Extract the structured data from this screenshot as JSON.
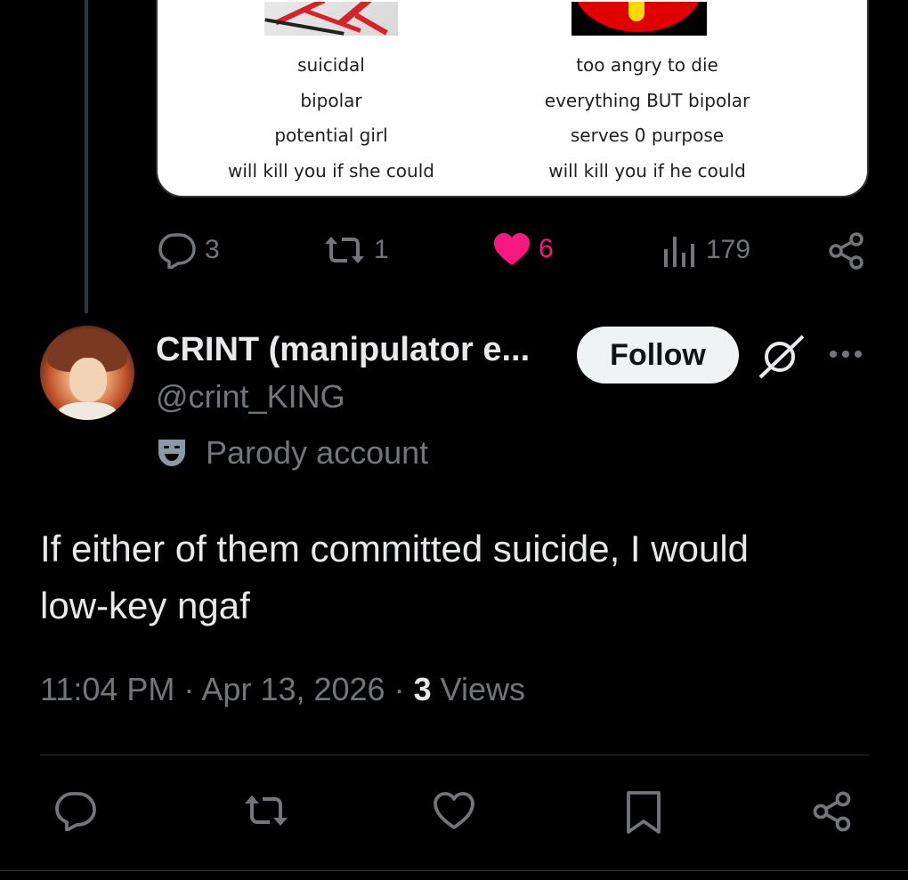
{
  "card": {
    "left_lines": [
      "suicidal",
      "bipolar",
      "potential girl",
      "will kill you if she could"
    ],
    "right_lines": [
      "too angry to die",
      "everything BUT bipolar",
      "serves 0 purpose",
      "will kill you if he could"
    ]
  },
  "parent_actions": {
    "replies": "3",
    "reposts": "1",
    "likes": "6",
    "views": "179"
  },
  "user": {
    "name": "CRINT (manipulator e...",
    "handle": "@crint_KING",
    "label": "Parody account"
  },
  "follow_label": "Follow",
  "tweet": {
    "text_line1": "If either of them committed suicide, I would",
    "text_line2": "low-key ngaf",
    "time": "11:04 PM · Apr 13, 2026 · ",
    "views_count": "3",
    "views_label": " Views"
  },
  "colors": {
    "like_active": "#f91880",
    "muted": "#71767b",
    "text": "#e7e9ea"
  },
  "icons": [
    "reply-icon",
    "repost-icon",
    "like-icon",
    "views-icon",
    "share-icon",
    "grok-icon",
    "more-icon",
    "parody-mask-icon",
    "bookmark-icon"
  ]
}
